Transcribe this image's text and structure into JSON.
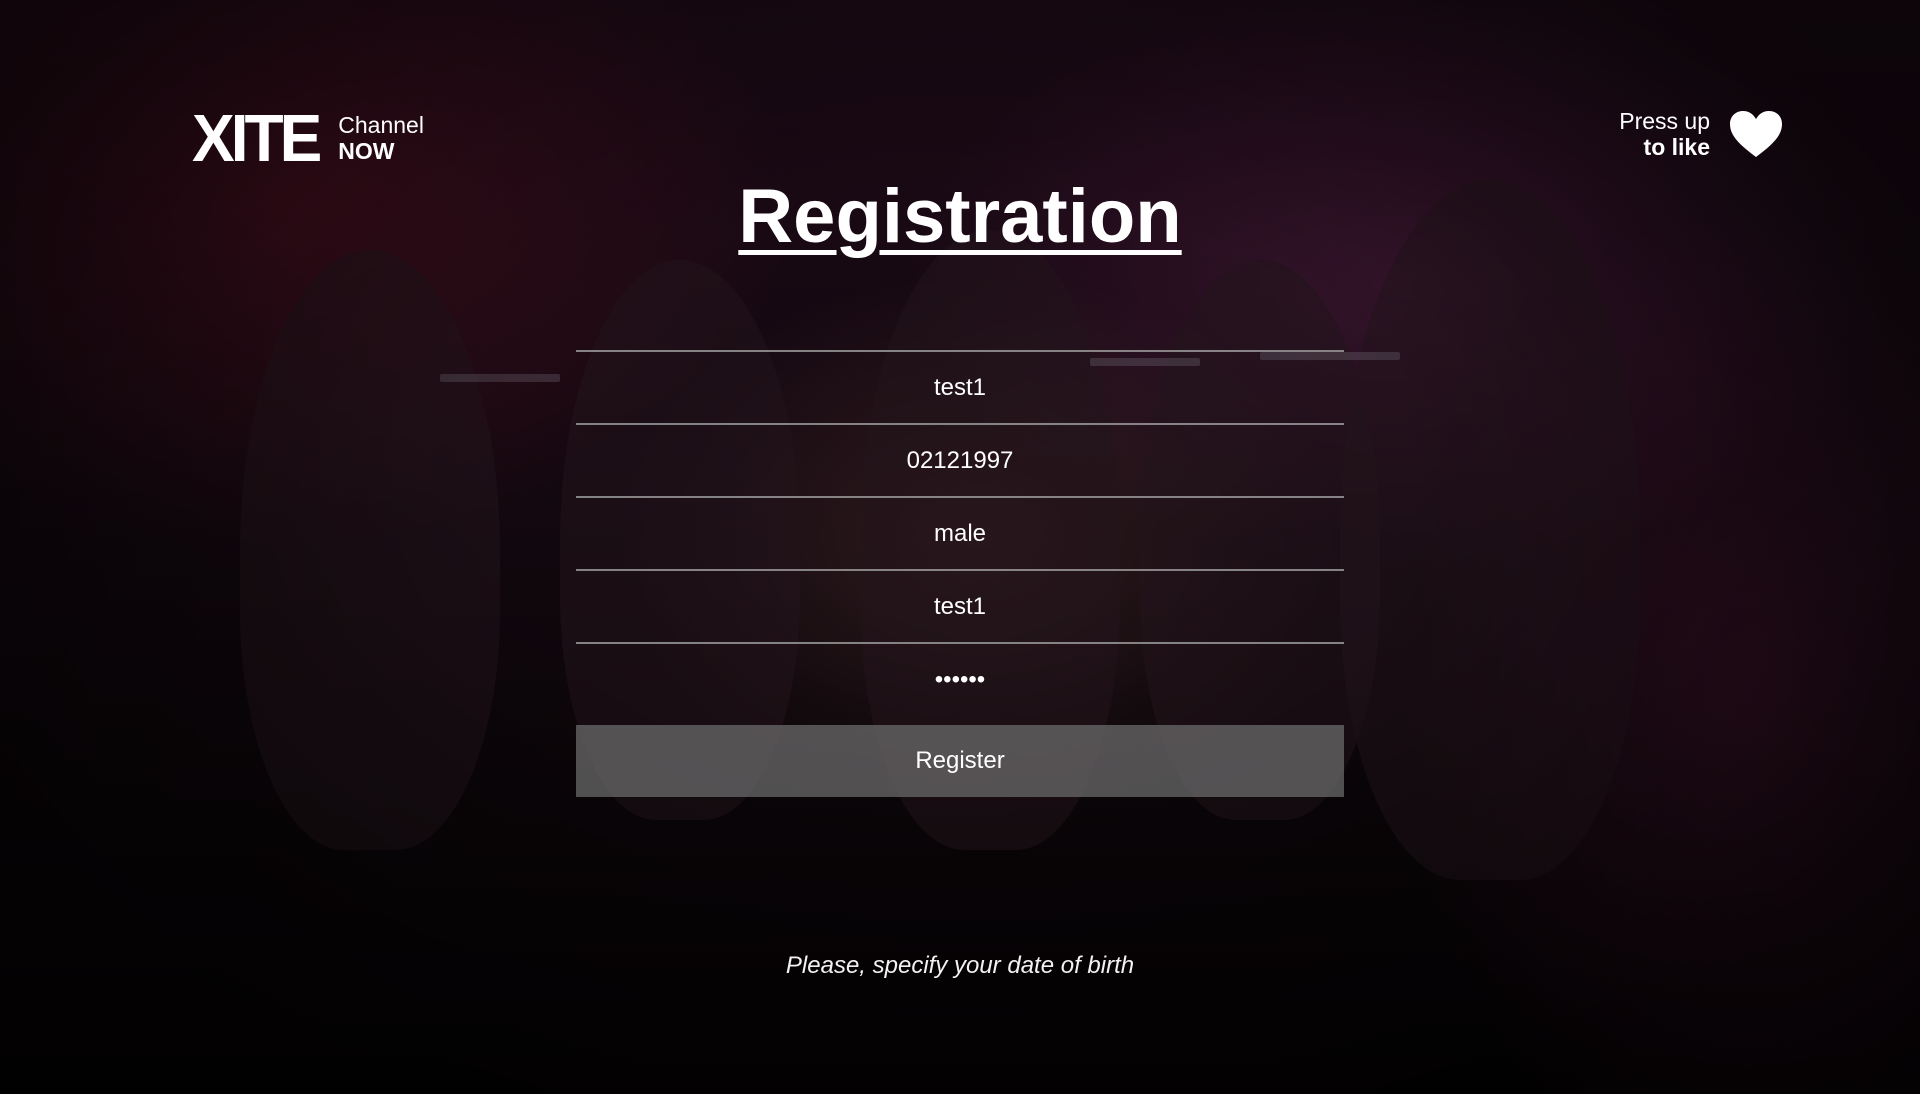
{
  "header": {
    "logo_text": "XITE",
    "channel_label": "Channel",
    "channel_sub": "NOW",
    "like_line1": "Press up",
    "like_line2": "to like",
    "like_icon": "heart-icon"
  },
  "page": {
    "title": "Registration"
  },
  "form": {
    "fields": [
      {
        "value": "test1"
      },
      {
        "value": "02121997"
      },
      {
        "value": "male"
      },
      {
        "value": "test1"
      },
      {
        "value": "••••••"
      }
    ],
    "register_label": "Register"
  },
  "hint": "Please, specify your date of birth",
  "colors": {
    "background": "#140810",
    "text": "#ffffff",
    "divider": "#aaaaaa",
    "button": "#6e6e6e"
  }
}
